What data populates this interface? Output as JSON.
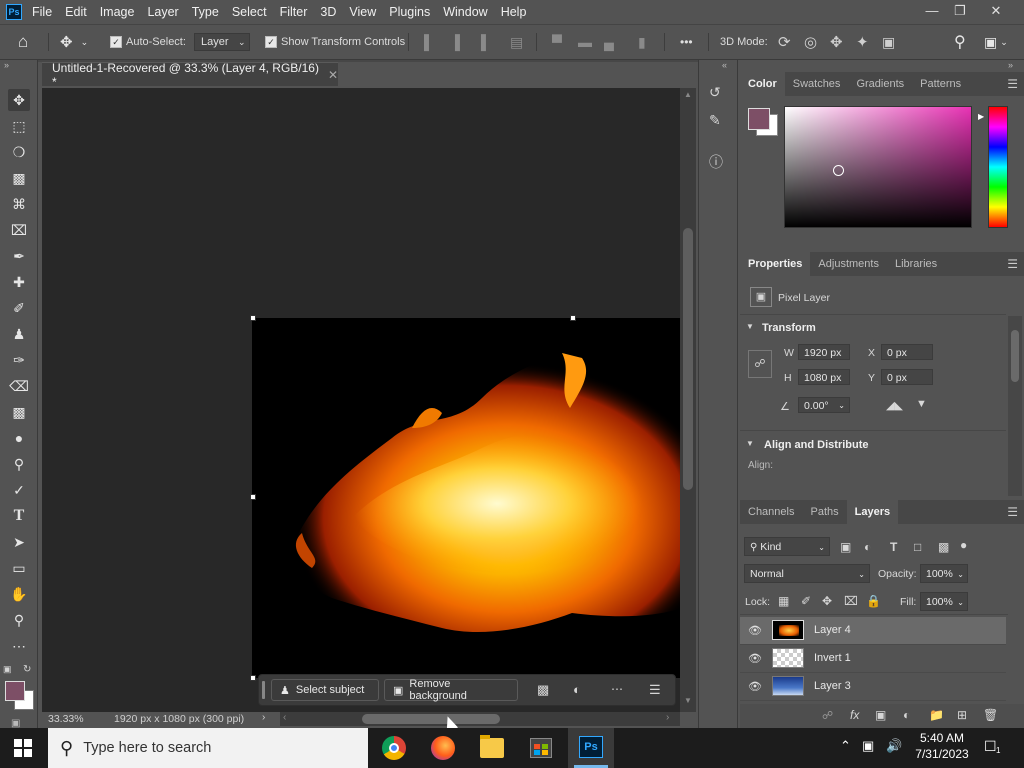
{
  "app": {
    "logo": "Ps",
    "menus": [
      "File",
      "Edit",
      "Image",
      "Layer",
      "Type",
      "Select",
      "Filter",
      "3D",
      "View",
      "Plugins",
      "Window",
      "Help"
    ]
  },
  "options": {
    "auto_select_label": "Auto-Select:",
    "auto_select_value": "Layer",
    "show_transform_label": "Show Transform Controls",
    "mode3d_label": "3D Mode:",
    "more": "•••"
  },
  "document": {
    "tab_title": "Untitled-1-Recovered @ 33.3% (Layer 4, RGB/16) *",
    "zoom": "33.33%",
    "size_info": "1920 px x 1080 px (300 ppi)"
  },
  "context_bar": {
    "select_subject": "Select subject",
    "remove_background": "Remove background"
  },
  "color_panel": {
    "tabs": [
      "Color",
      "Swatches",
      "Gradients",
      "Patterns"
    ],
    "foreground": "#7d4f66",
    "background": "#ffffff",
    "field_hue": "#e832b4"
  },
  "properties_panel": {
    "tabs": [
      "Properties",
      "Adjustments",
      "Libraries"
    ],
    "kind": "Pixel Layer",
    "transform_title": "Transform",
    "w_label": "W",
    "w_value": "1920 px",
    "h_label": "H",
    "h_value": "1080 px",
    "x_label": "X",
    "x_value": "0 px",
    "y_label": "Y",
    "y_value": "0 px",
    "angle": "0.00°",
    "align_title": "Align and Distribute",
    "align_label": "Align:"
  },
  "layers_panel": {
    "tabs": [
      "Channels",
      "Paths",
      "Layers"
    ],
    "filter_kind": "Kind",
    "blend_mode": "Normal",
    "opacity_label": "Opacity:",
    "opacity": "100%",
    "lock_label": "Lock:",
    "fill_label": "Fill:",
    "fill": "100%",
    "layers": [
      {
        "name": "Layer 4",
        "selected": true
      },
      {
        "name": "Invert 1",
        "selected": false
      },
      {
        "name": "Layer 3",
        "selected": false
      }
    ]
  },
  "taskbar": {
    "search_placeholder": "Type here to search",
    "time": "5:40 AM",
    "date": "7/31/2023",
    "notification_count": "1",
    "ps_label": "Ps"
  }
}
